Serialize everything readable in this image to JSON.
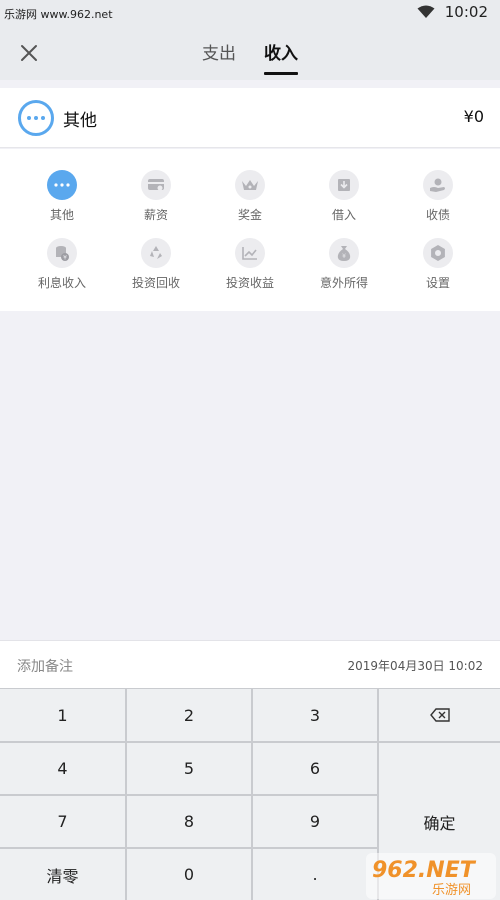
{
  "status": {
    "watermark": "乐游网 www.962.net",
    "time": "10:02"
  },
  "header": {
    "tabs": [
      {
        "label": "支出",
        "active": false
      },
      {
        "label": "收入",
        "active": true
      }
    ]
  },
  "selected": {
    "label": "其他",
    "amount": "¥0",
    "icon": "more-dots-icon"
  },
  "categories": [
    {
      "label": "其他",
      "icon": "more-dots-icon",
      "active": true
    },
    {
      "label": "薪资",
      "icon": "salary-card-icon"
    },
    {
      "label": "奖金",
      "icon": "crown-icon"
    },
    {
      "label": "借入",
      "icon": "borrow-in-icon"
    },
    {
      "label": "收债",
      "icon": "debt-collect-icon"
    },
    {
      "label": "利息收入",
      "icon": "coins-icon"
    },
    {
      "label": "投资回收",
      "icon": "recycle-icon"
    },
    {
      "label": "投资收益",
      "icon": "line-chart-icon"
    },
    {
      "label": "意外所得",
      "icon": "money-bag-icon"
    },
    {
      "label": "设置",
      "icon": "gear-icon"
    }
  ],
  "note": {
    "placeholder": "添加备注",
    "date": "2019年04月30日 10:02"
  },
  "keypad": {
    "k1": "1",
    "k2": "2",
    "k3": "3",
    "k4": "4",
    "k5": "5",
    "k6": "6",
    "k7": "7",
    "k8": "8",
    "k9": "9",
    "clear": "清零",
    "k0": "0",
    "dot": ".",
    "confirm": "确定",
    "backspace_icon": "backspace-icon"
  },
  "watermark_logo": {
    "text": "962.NET",
    "subtext": "乐游网"
  },
  "colors": {
    "accent": "#5aa8ee",
    "header_bg": "#e9ebee",
    "page_bg": "#f1f1f6",
    "logo_orange": "#f0922a"
  }
}
